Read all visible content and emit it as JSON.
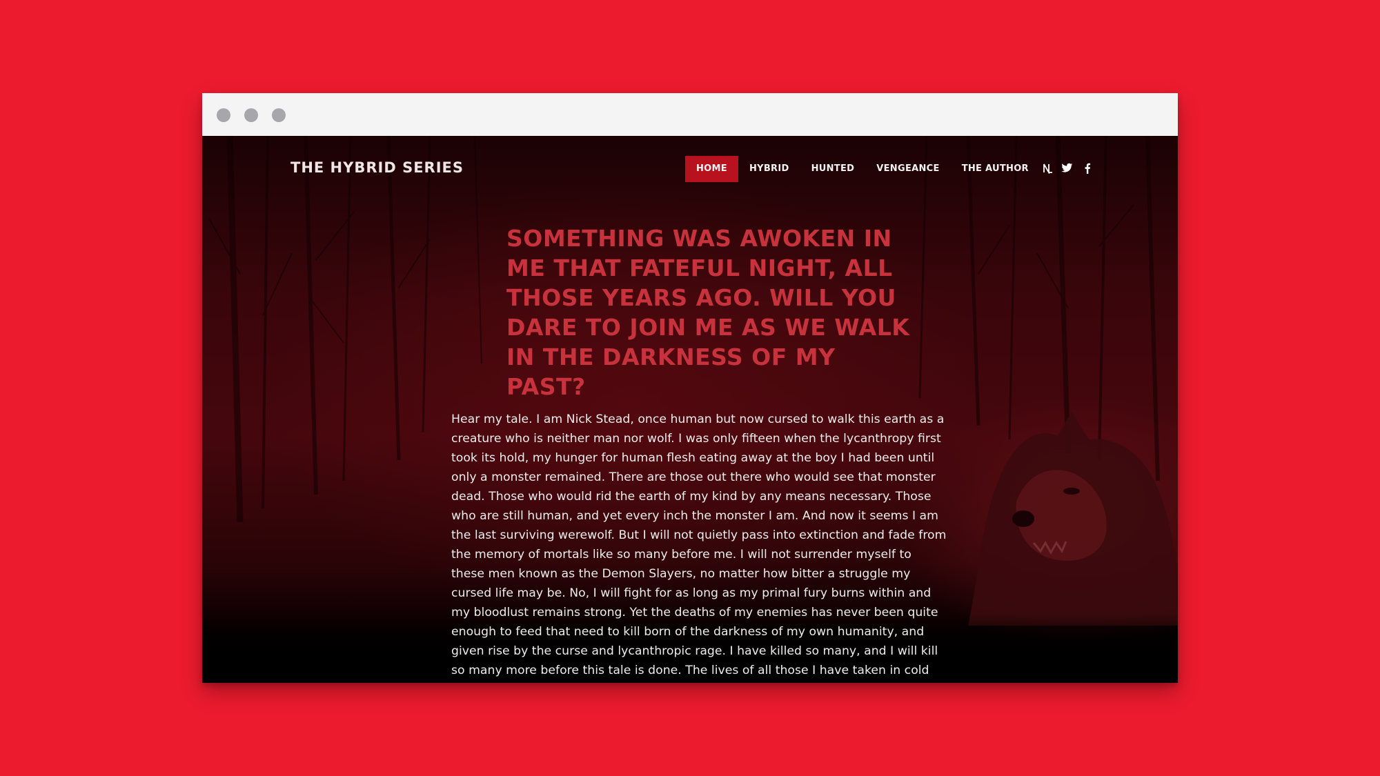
{
  "browser": {
    "window_controls": [
      "close",
      "minimize",
      "maximize"
    ]
  },
  "site": {
    "title": "THE HYBRID SERIES"
  },
  "nav": {
    "items": [
      {
        "label": "HOME",
        "active": true
      },
      {
        "label": "HYBRID",
        "active": false
      },
      {
        "label": "HUNTED",
        "active": false
      },
      {
        "label": "VENGEANCE",
        "active": false
      },
      {
        "label": "THE AUTHOR",
        "active": false
      }
    ]
  },
  "social": {
    "icons": [
      "goodreads-icon",
      "twitter-icon",
      "facebook-icon"
    ],
    "glyphs": [
      "ℕ",
      "",
      "f"
    ]
  },
  "hero": {
    "headline": "SOMETHING WAS AWOKEN IN ME THAT FATEFUL NIGHT, ALL THOSE YEARS AGO. WILL YOU DARE TO JOIN ME AS WE WALK IN THE DARKNESS OF MY PAST?",
    "body": "Hear my tale. I am Nick Stead, once human but now cursed to walk this earth as a creature who is neither man nor wolf. I was only fifteen when the lycanthropy first took its hold, my hunger for human flesh eating away at the boy I had been until only a monster remained. There are those out there who would see that monster dead. Those who would rid the earth of my kind by any means necessary. Those who are still human, and yet every inch the monster I am. And now it seems I am the last surviving werewolf. But I will not quietly pass into extinction and fade from the memory of mortals like so many before me. I will not surrender myself to these men known as the Demon Slayers, no matter how bitter a struggle my cursed life may be. No, I will fight for as long as my primal fury burns within and my bloodlust remains strong. Yet the deaths of my enemies has never been quite enough to feed that need to kill born of the darkness of my own humanity, and given rise by the curse and lycanthropic rage. I have killed so many, and I will kill so many more before this tale is done. The lives of all those I have taken in cold blood still weigh on"
  },
  "colors": {
    "page_background": "#ec1b2e",
    "nav_active": "#b8121f",
    "headline": "#c8323c",
    "chrome": "#f4f4f4"
  }
}
